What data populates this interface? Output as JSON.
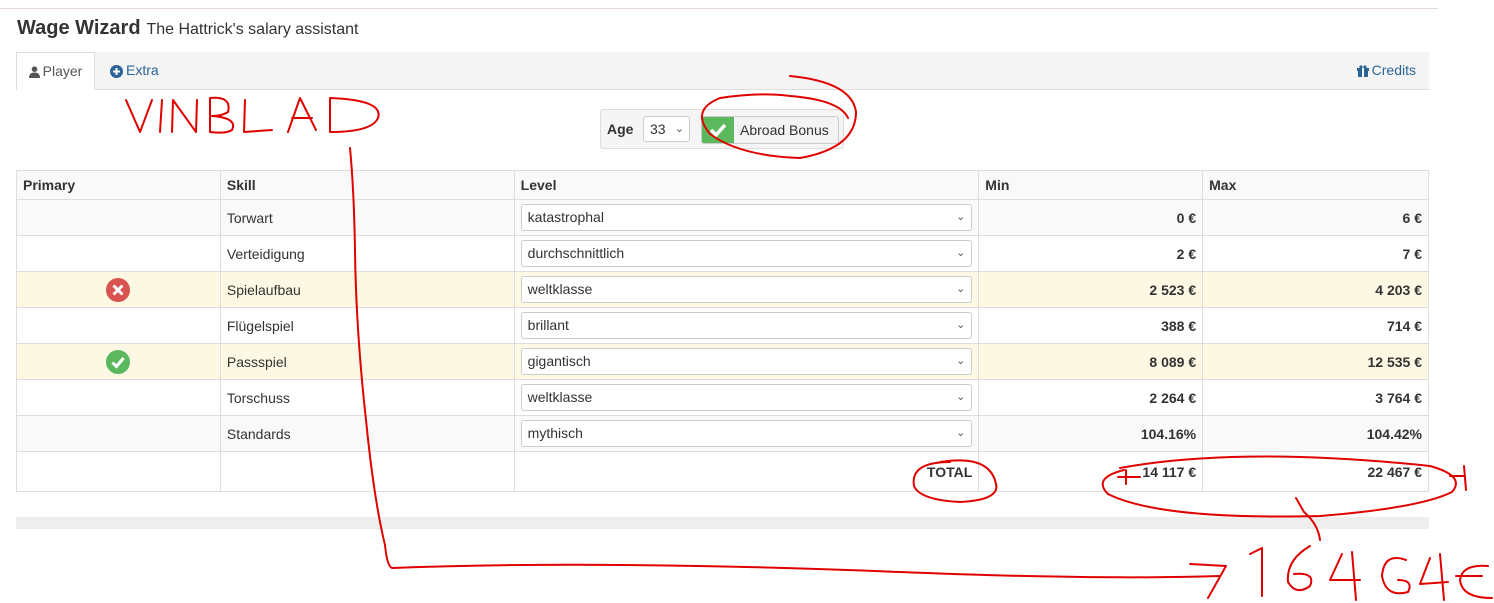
{
  "header": {
    "title": "Wage Wizard",
    "subtitle": "The Hattrick's salary assistant"
  },
  "tabs": [
    {
      "label": "Player",
      "icon": "user-icon",
      "active": true
    },
    {
      "label": "Extra",
      "icon": "plus-circle-icon"
    },
    {
      "label": "Credits",
      "icon": "gift-icon"
    }
  ],
  "controls": {
    "age_label": "Age",
    "age_value": "33",
    "abroad_label": "Abroad Bonus",
    "abroad_checked": true
  },
  "table": {
    "headers": [
      "Primary",
      "Skill",
      "Level",
      "Min",
      "Max"
    ],
    "rows": [
      {
        "primary": "",
        "skill": "Torwart",
        "level": "katastrophal",
        "min": "0 €",
        "max": "6 €"
      },
      {
        "primary": "",
        "skill": "Verteidigung",
        "level": "durchschnittlich",
        "min": "2 €",
        "max": "7 €"
      },
      {
        "primary": "x-circle-icon",
        "skill": "Spielaufbau",
        "level": "weltklasse",
        "min": "2 523 €",
        "max": "4 203 €"
      },
      {
        "primary": "",
        "skill": "Flügelspiel",
        "level": "brillant",
        "min": "388 €",
        "max": "714 €"
      },
      {
        "primary": "check-circle-icon",
        "skill": "Passspiel",
        "level": "gigantisch",
        "min": "8 089 €",
        "max": "12 535 €"
      },
      {
        "primary": "",
        "skill": "Torschuss",
        "level": "weltklasse",
        "min": "2 264 €",
        "max": "3 764 €"
      },
      {
        "primary": "",
        "skill": "Standards",
        "level": "mythisch",
        "min": "104.16%",
        "max": "104.42%"
      }
    ],
    "total_label": "TOTAL",
    "total_min": "14 117 €",
    "total_max": "22 467 €"
  },
  "annotations": {
    "color": "#e00000",
    "name_text": "VINBLAD",
    "result_text": "7 1 6 4 G 4 €"
  },
  "colors": {
    "link": "#2a6496",
    "success": "#5cb85c",
    "danger": "#d9534f",
    "warning_row": "#fcf8e3"
  }
}
